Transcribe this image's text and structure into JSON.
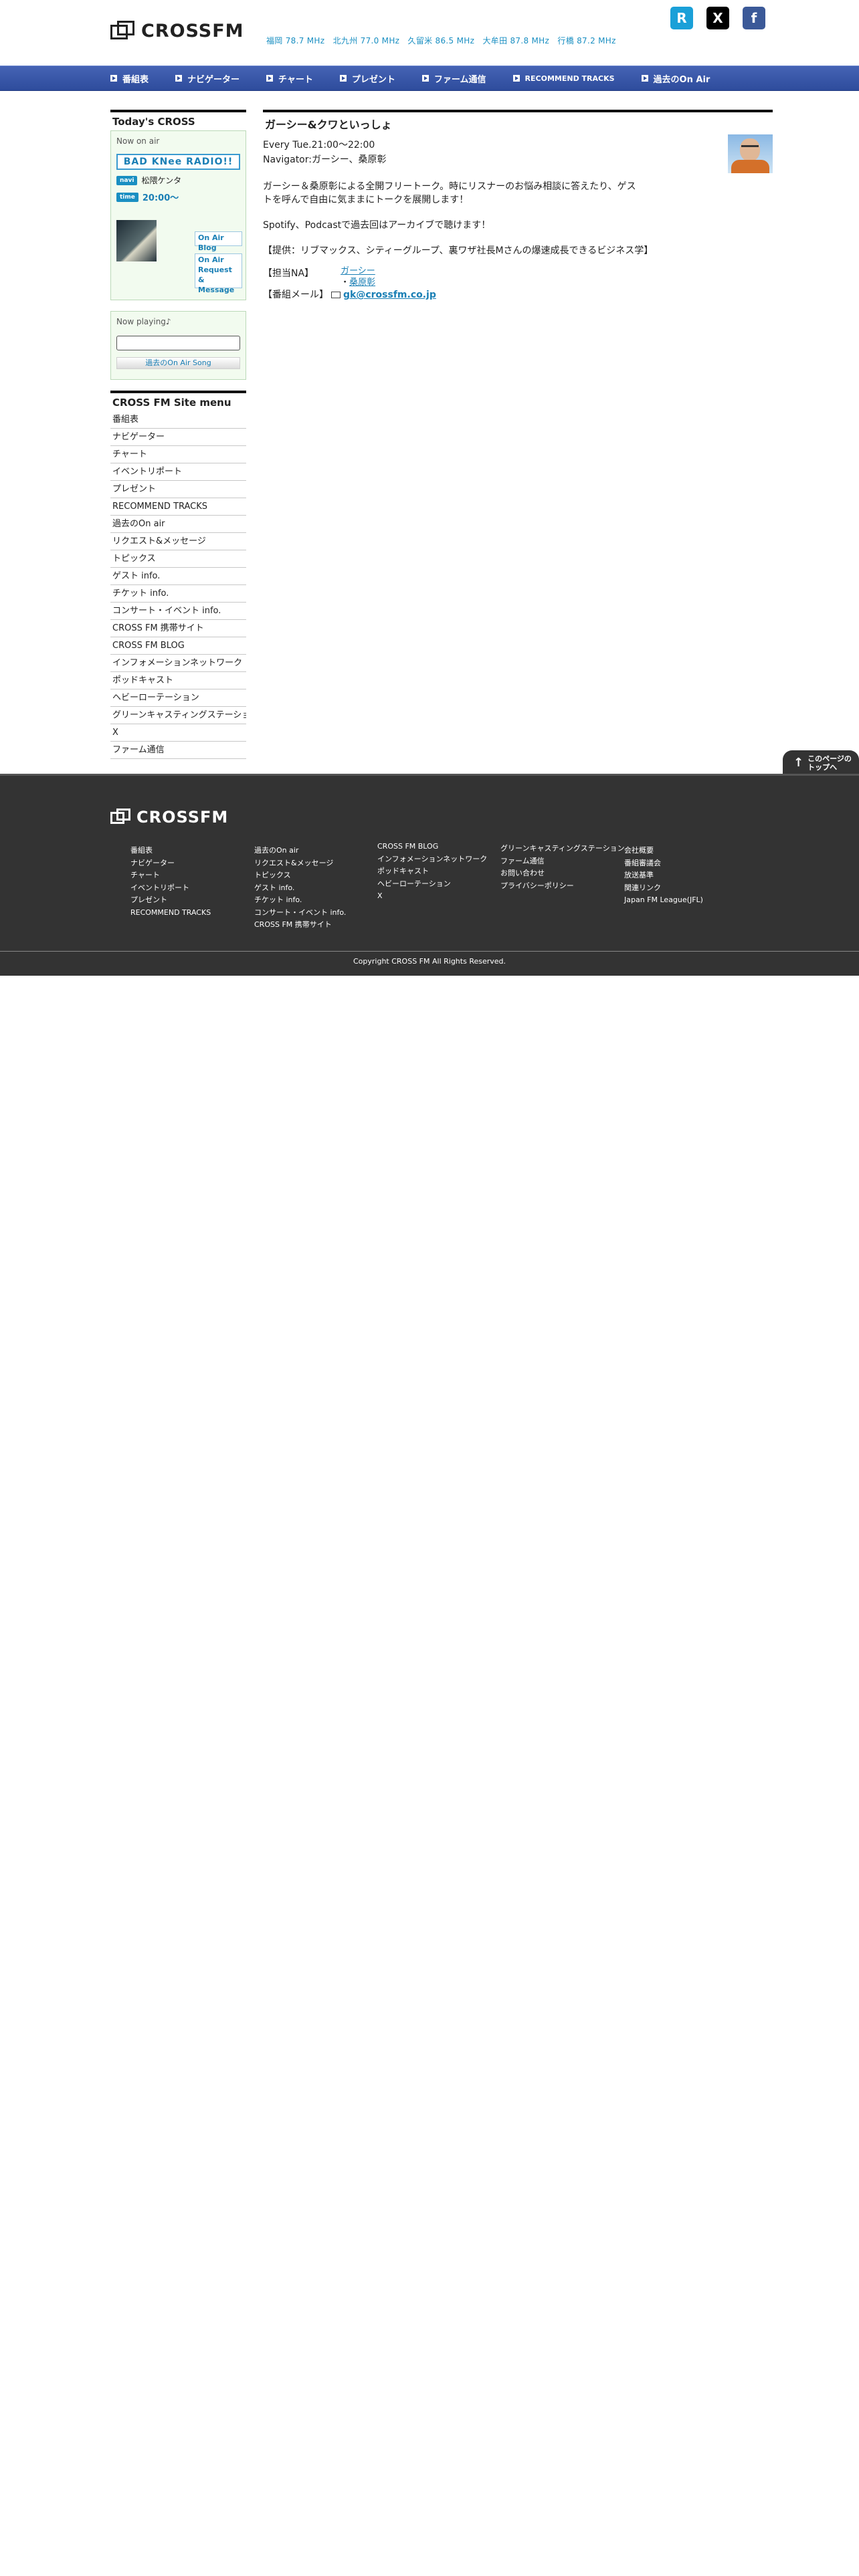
{
  "header": {
    "logo_text": "CROSSFM",
    "frequencies": "福岡 78.7 MHz　北九州 77.0 MHz　久留米 86.5 MHz　大牟田 87.8 MHz　行橋 87.2 MHz",
    "social": [
      {
        "name": "radiko-icon",
        "glyph": "R"
      },
      {
        "name": "x-icon",
        "glyph": "X"
      },
      {
        "name": "facebook-icon",
        "glyph": "f"
      }
    ]
  },
  "nav": {
    "items": [
      "番組表",
      "ナビゲーター",
      "チャート",
      "プレゼント",
      "ファーム通信",
      "RECOMMEND TRACKS",
      "過去のOn Air"
    ]
  },
  "sidebar": {
    "todays_title": "Today's CROSS",
    "now_on_air_label": "Now on air",
    "program_name": "BAD KNee RADIO!!",
    "navi_tag": "navi",
    "navigator": "松隈ケンタ",
    "time_tag": "time",
    "time": "20:00～",
    "blog_btn": "On Air Blog",
    "request_btn_line1": "On Air",
    "request_btn_line2": "Request &",
    "request_btn_line3": "Message",
    "now_playing_label": "Now playing♪",
    "past_song_btn": "過去のOn Air Song",
    "menu_title": "CROSS FM Site menu",
    "menu": [
      "番組表",
      "ナビゲーター",
      "チャート",
      "イベントリポート",
      "プレゼント",
      "RECOMMEND TRACKS",
      "過去のOn air",
      "リクエスト&メッセージ",
      "トピックス",
      "ゲスト info.",
      "チケット info.",
      "コンサート・イベント info.",
      "CROSS FM 携帯サイト",
      "CROSS FM BLOG",
      "インフォメーションネットワーク",
      "ポッドキャスト",
      "ヘビーローテーション",
      "グリーンキャスティングステーション",
      "X",
      "ファーム通信"
    ]
  },
  "main": {
    "title": "ガーシー&クワといっしょ",
    "schedule": "Every Tue.21:00～22:00",
    "navigator_line": "Navigator:ガーシー、桑原彰",
    "description": "ガーシー＆桑原彰による全開フリートーク。時にリスナーのお悩み相談に答えたり、ゲストを呼んで自由に気ままにトークを展開します！",
    "archive": "Spotify、Podcastで過去回はアーカイブで聴けます！",
    "sponsor": "【提供：リブマックス、シティーグループ、裏ワザ社長Mさんの爆速成長できるビジネス学】",
    "staff_label": "【担当NA】",
    "staff": [
      "ガーシー",
      "桑原彰"
    ],
    "mail_label": "【番組メール】",
    "mail": "gk@crossfm.co.jp"
  },
  "page_top": {
    "line1": "このページの",
    "line2": "トップへ"
  },
  "footer": {
    "logo_text": "CROSSFM",
    "col1": [
      "番組表",
      "ナビゲーター",
      "チャート",
      "イベントリポート",
      "プレゼント",
      "RECOMMEND TRACKS"
    ],
    "col2": [
      "過去のOn air",
      "リクエスト&メッセージ",
      "トピックス",
      "ゲスト info.",
      "チケット info.",
      "コンサート・イベント info.",
      "CROSS FM 携帯サイト"
    ],
    "col3": [
      "CROSS FM BLOG",
      "インフォメーションネットワーク",
      "ポッドキャスト",
      "ヘビーローテーション",
      "X"
    ],
    "col4": [
      "グリーンキャスティングステーション",
      "ファーム通信",
      "お問い合わせ",
      "プライバシーポリシー"
    ],
    "col5": [
      "会社概要",
      "番組審議会",
      "放送基準",
      "関連リンク",
      "Japan FM League(JFL)"
    ],
    "copyright": "Copyright CROSS FM All Rights Reserved."
  }
}
